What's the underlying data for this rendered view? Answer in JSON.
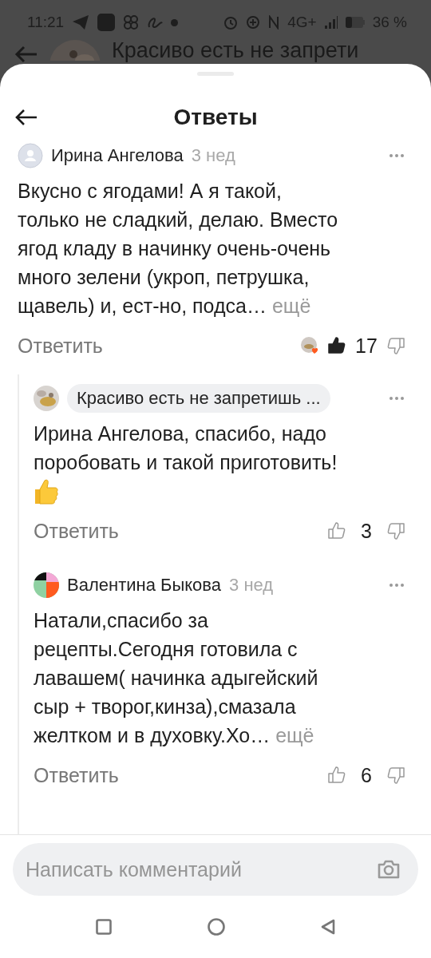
{
  "status_bar": {
    "time": "11:21",
    "network": "4G+",
    "battery": "36 %"
  },
  "background_header": {
    "title": "Красиво есть не запрети"
  },
  "sheet": {
    "title": "Ответы"
  },
  "comments": [
    {
      "avatar": {
        "kind": "placeholder"
      },
      "author": "Ирина Ангелова",
      "highlighted": false,
      "time": "3 нед",
      "text": "Вкусно с ягодами! А я такой,\nтолько не сладкий, делаю. Вместо\nягод кладу в начинку очень-очень\nмного зелени (укроп, петрушка,\nщавель) и, ест-но, подса…",
      "more": "ещё",
      "emoji": false,
      "reply": "Ответить",
      "likes": "17",
      "liked": true,
      "reactor": true,
      "replies": [
        {
          "author": "Красиво есть не запретишь ...",
          "highlighted": true,
          "text": "Ирина Ангелова, спасибо, надо\nпоробовать и такой приготовить!",
          "emoji": true,
          "reply": "Ответить",
          "likes": "3",
          "liked": false,
          "reactor": false
        },
        {
          "avatar": {
            "kind": "mosaic"
          },
          "author": "Валентина Быкова",
          "highlighted": false,
          "time": "3 нед",
          "text": "Натали,спасибо за\nрецепты.Сегодня готовила с\nлавашем( начинка адыгейский\nсыр + творог,кинза),смазала\nжелтком и в духовку.Хо…",
          "more": "ещё",
          "emoji": false,
          "reply": "Ответить",
          "likes": "6",
          "liked": false,
          "reactor": false
        }
      ]
    }
  ],
  "composer": {
    "placeholder": "Написать комментарий"
  }
}
